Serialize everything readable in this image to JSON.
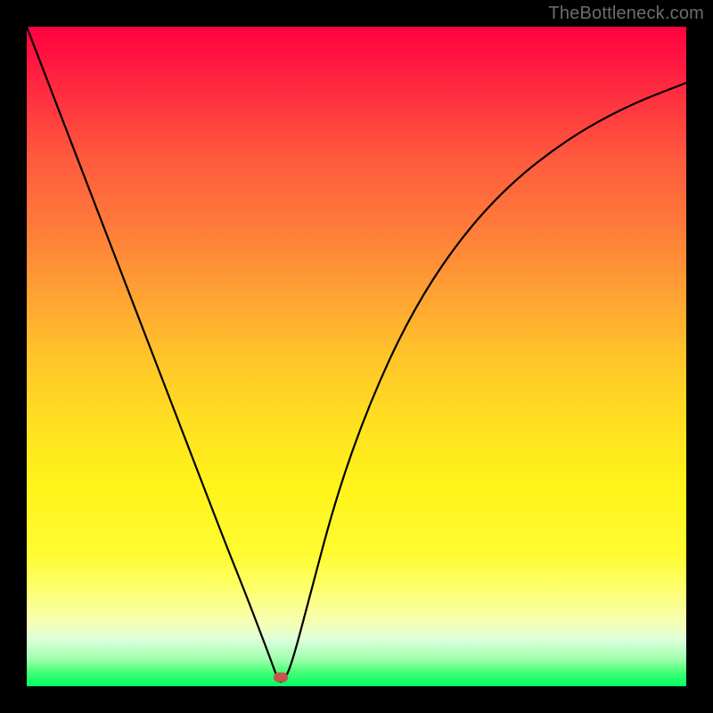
{
  "watermark": "TheBottleneck.com",
  "chart_data": {
    "type": "line",
    "title": "",
    "xlabel": "",
    "ylabel": "",
    "xlim": [
      0,
      1
    ],
    "ylim": [
      0,
      1
    ],
    "legend": false,
    "grid": false,
    "annotations": [
      {
        "kind": "marker",
        "x": 0.385,
        "y": 0.013,
        "color": "#c1584a"
      }
    ],
    "series": [
      {
        "name": "curve",
        "x": [
          0.0,
          0.05,
          0.1,
          0.15,
          0.2,
          0.25,
          0.3,
          0.33,
          0.355,
          0.37,
          0.378,
          0.383,
          0.392,
          0.405,
          0.43,
          0.47,
          0.52,
          0.58,
          0.65,
          0.73,
          0.82,
          0.91,
          1.0
        ],
        "y": [
          1.0,
          0.87,
          0.74,
          0.61,
          0.48,
          0.35,
          0.22,
          0.145,
          0.08,
          0.04,
          0.018,
          0.005,
          0.01,
          0.045,
          0.14,
          0.29,
          0.43,
          0.56,
          0.67,
          0.76,
          0.83,
          0.88,
          0.915
        ]
      }
    ]
  },
  "colors": {
    "background_top": "#ff0040",
    "background_bottom": "#00ff66",
    "curve": "#000000",
    "marker": "#c1584a",
    "watermark": "#6d6d6d",
    "frame": "#000000"
  }
}
